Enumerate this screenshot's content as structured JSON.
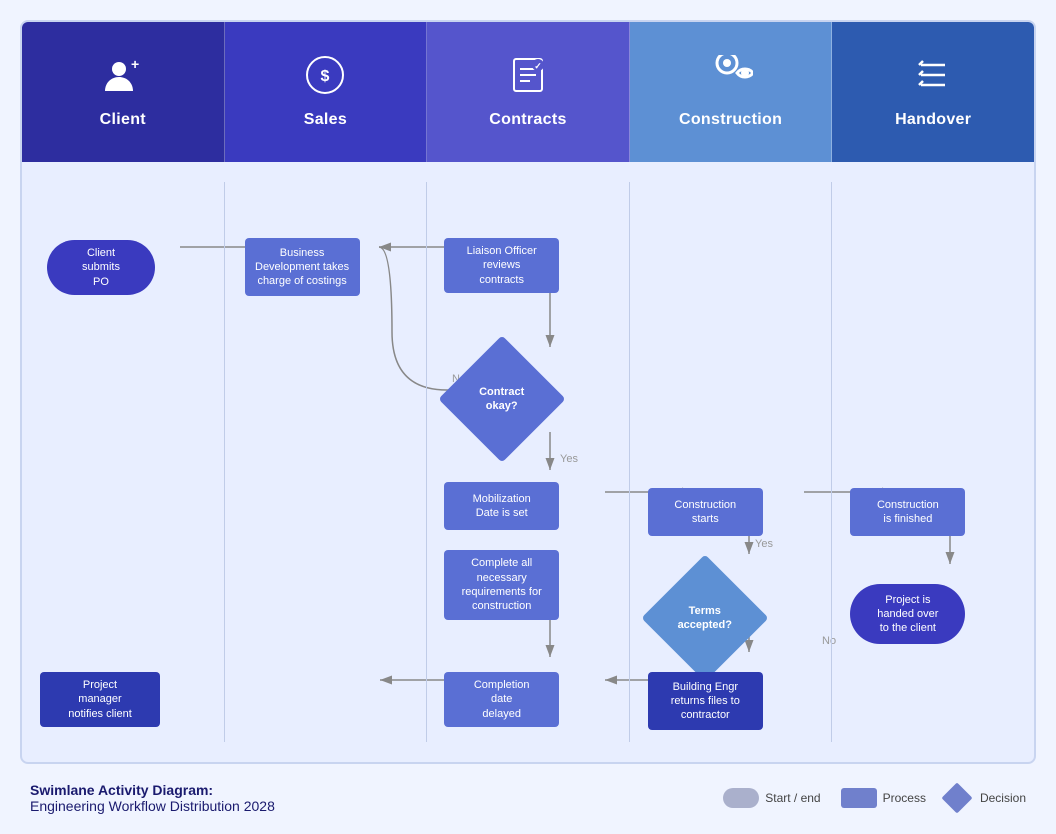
{
  "headers": [
    {
      "id": "client",
      "label": "Client",
      "icon": "👤+",
      "class": "header-client"
    },
    {
      "id": "sales",
      "label": "Sales",
      "icon": "💰",
      "class": "header-sales"
    },
    {
      "id": "contracts",
      "label": "Contracts",
      "icon": "📋",
      "class": "header-contracts"
    },
    {
      "id": "construction",
      "label": "Construction",
      "icon": "⚙️",
      "class": "header-construction"
    },
    {
      "id": "handover",
      "label": "Handover",
      "icon": "✅",
      "class": "header-handover"
    }
  ],
  "nodes": {
    "client_submits": "Client\nsubmits\nPO",
    "biz_dev": "Business\nDevelopment takes\ncharge of costings",
    "liaison_officer": "Liaison Officer\nreviews\ncontracts",
    "contract_okay": "Contract\nokay?",
    "mobilization": "Mobilization\nDate is set",
    "complete_reqs": "Complete all\nnecessary\nrequirements for\nconstruction",
    "completion_delayed": "Completion\ndate\ndelayed",
    "construction_starts": "Construction\nstarts",
    "terms_accepted": "Terms\naccepted?",
    "building_engr": "Building Engr\nreturns files to\ncontractor",
    "construction_finished": "Construction\nis finished",
    "project_handover": "Project is\nhanded over\nto the client",
    "project_manager": "Project\nmanager\nnotifies client",
    "label_no1": "No",
    "label_yes1": "Yes",
    "label_yes2": "Yes",
    "label_no2": "No"
  },
  "footer": {
    "title_bold": "Swimlane Activity Diagram:",
    "title_normal": "Engineering Workflow Distribution 2028",
    "legend": [
      {
        "shape": "stadium",
        "label": "Start / end"
      },
      {
        "shape": "rect",
        "label": "Process"
      },
      {
        "shape": "diamond",
        "label": "Decision"
      }
    ]
  }
}
